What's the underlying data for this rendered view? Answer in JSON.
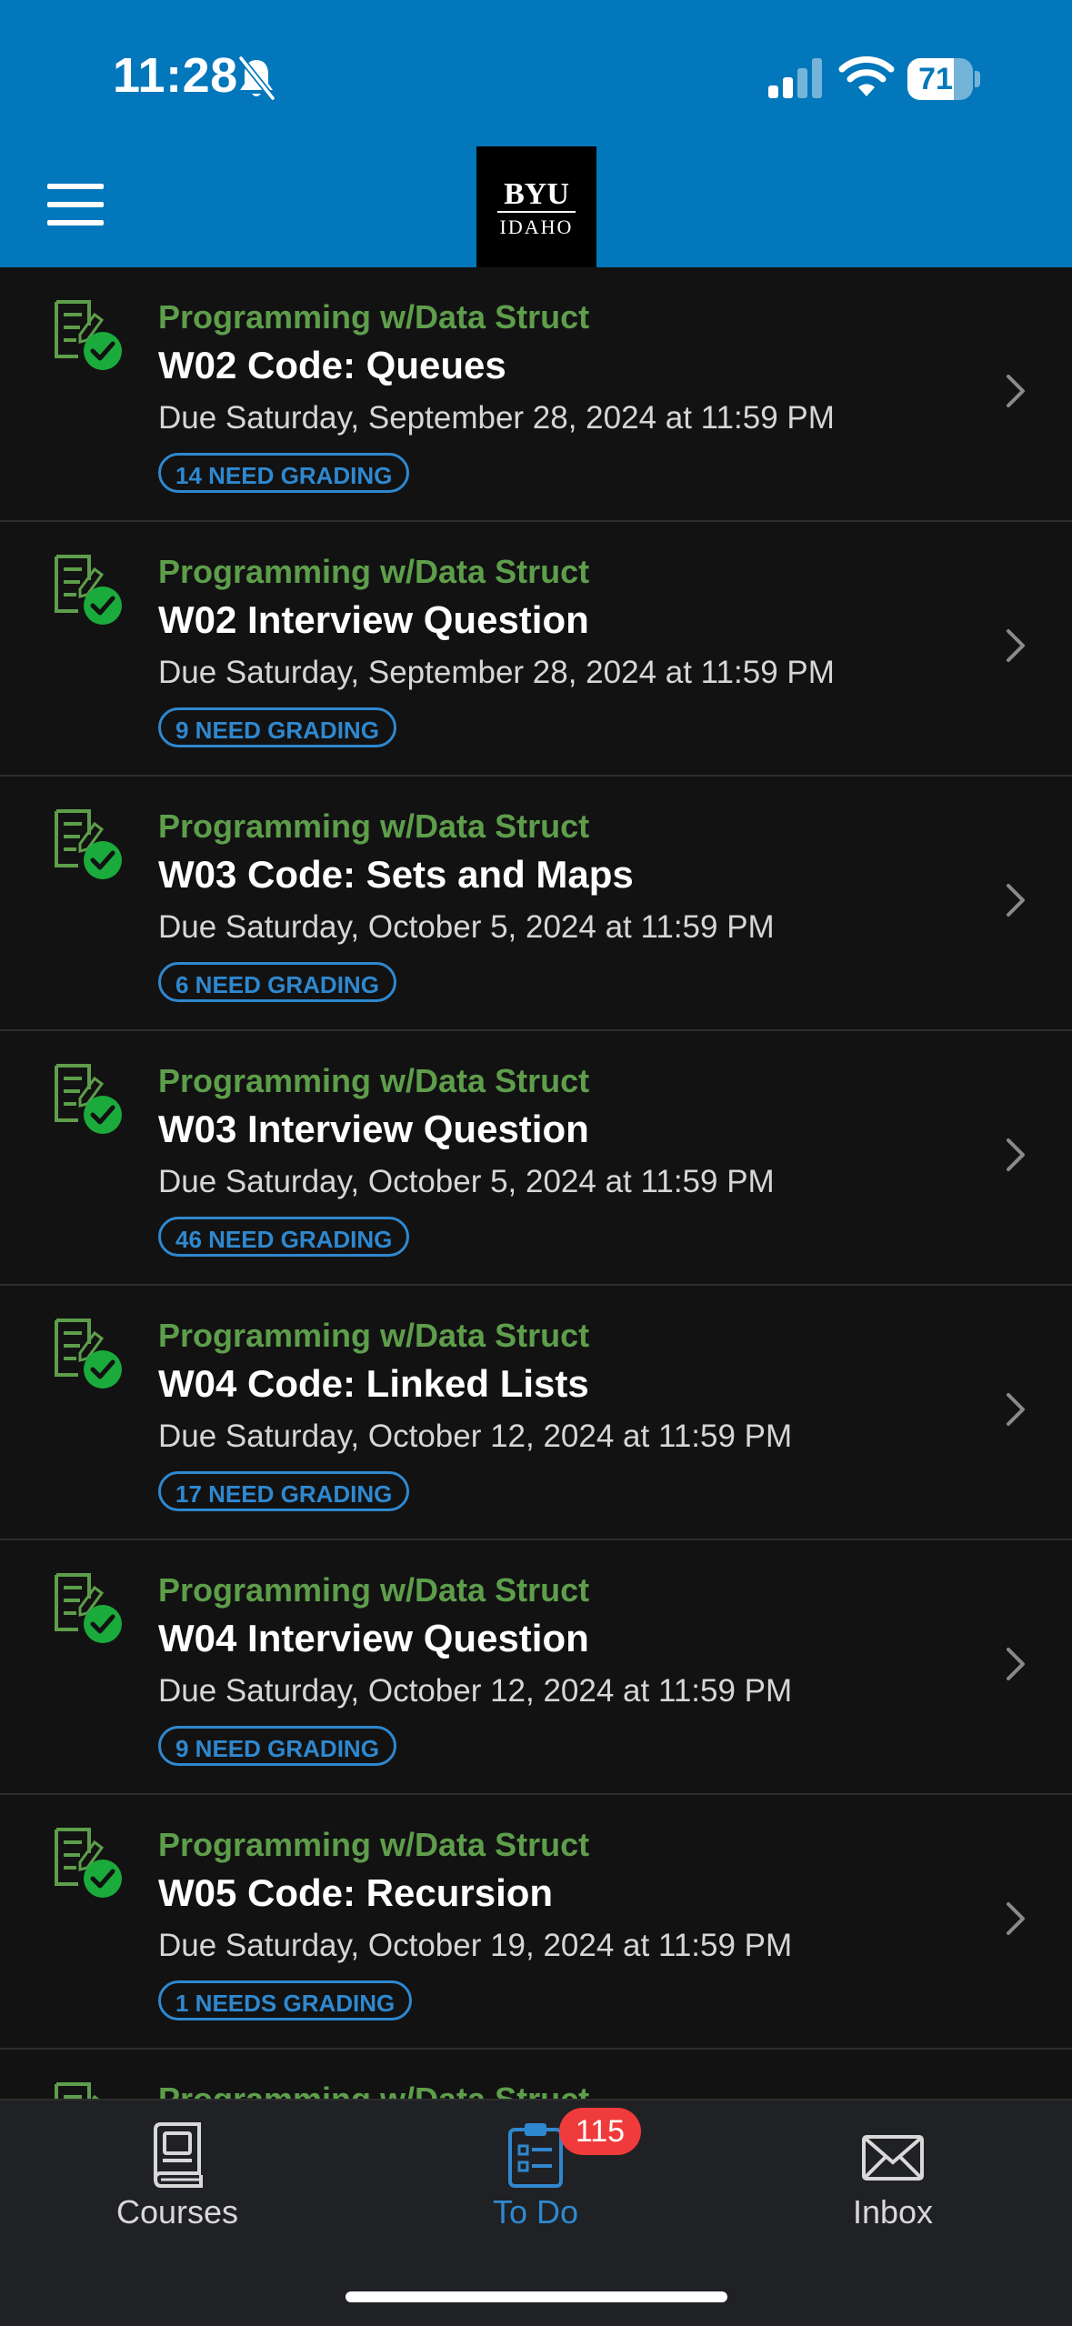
{
  "status_bar": {
    "time": "11:28",
    "battery_level": "71",
    "battery_fraction": 0.71
  },
  "header": {
    "logo_top": "BYU",
    "logo_bottom": "IDAHO"
  },
  "items": [
    {
      "course": "Programming w/Data Struct",
      "title": "W02 Code: Queues",
      "due": "Due Saturday, September 28, 2024 at 11:59 PM",
      "badge": "14 NEED GRADING"
    },
    {
      "course": "Programming w/Data Struct",
      "title": "W02 Interview Question",
      "due": "Due Saturday, September 28, 2024 at 11:59 PM",
      "badge": "9 NEED GRADING"
    },
    {
      "course": "Programming w/Data Struct",
      "title": "W03 Code: Sets and Maps",
      "due": "Due Saturday, October 5, 2024 at 11:59 PM",
      "badge": "6 NEED GRADING"
    },
    {
      "course": "Programming w/Data Struct",
      "title": "W03 Interview Question",
      "due": "Due Saturday, October 5, 2024 at 11:59 PM",
      "badge": "46 NEED GRADING"
    },
    {
      "course": "Programming w/Data Struct",
      "title": "W04 Code: Linked Lists",
      "due": "Due Saturday, October 12, 2024 at 11:59 PM",
      "badge": "17 NEED GRADING"
    },
    {
      "course": "Programming w/Data Struct",
      "title": "W04 Interview Question",
      "due": "Due Saturday, October 12, 2024 at 11:59 PM",
      "badge": "9 NEED GRADING"
    },
    {
      "course": "Programming w/Data Struct",
      "title": "W05 Code: Recursion",
      "due": "Due Saturday, October 19, 2024 at 11:59 PM",
      "badge": "1 NEEDS GRADING"
    },
    {
      "course": "Programming w/Data Struct",
      "title": "",
      "due": "",
      "badge": ""
    }
  ],
  "tabbar": {
    "courses_label": "Courses",
    "todo_label": "To Do",
    "todo_badge": "115",
    "inbox_label": "Inbox"
  },
  "colors": {
    "header": "#0377bb",
    "background": "#121212",
    "course_text": "#5e9e4b",
    "badge": "#2f88cf",
    "check": "#1aab3c",
    "notification": "#ef3b3b"
  },
  "icons": {
    "item": "assignment-check-icon",
    "chevron": "chevron-right-icon",
    "courses": "book-icon",
    "todo": "clipboard-icon",
    "inbox": "envelope-icon"
  }
}
